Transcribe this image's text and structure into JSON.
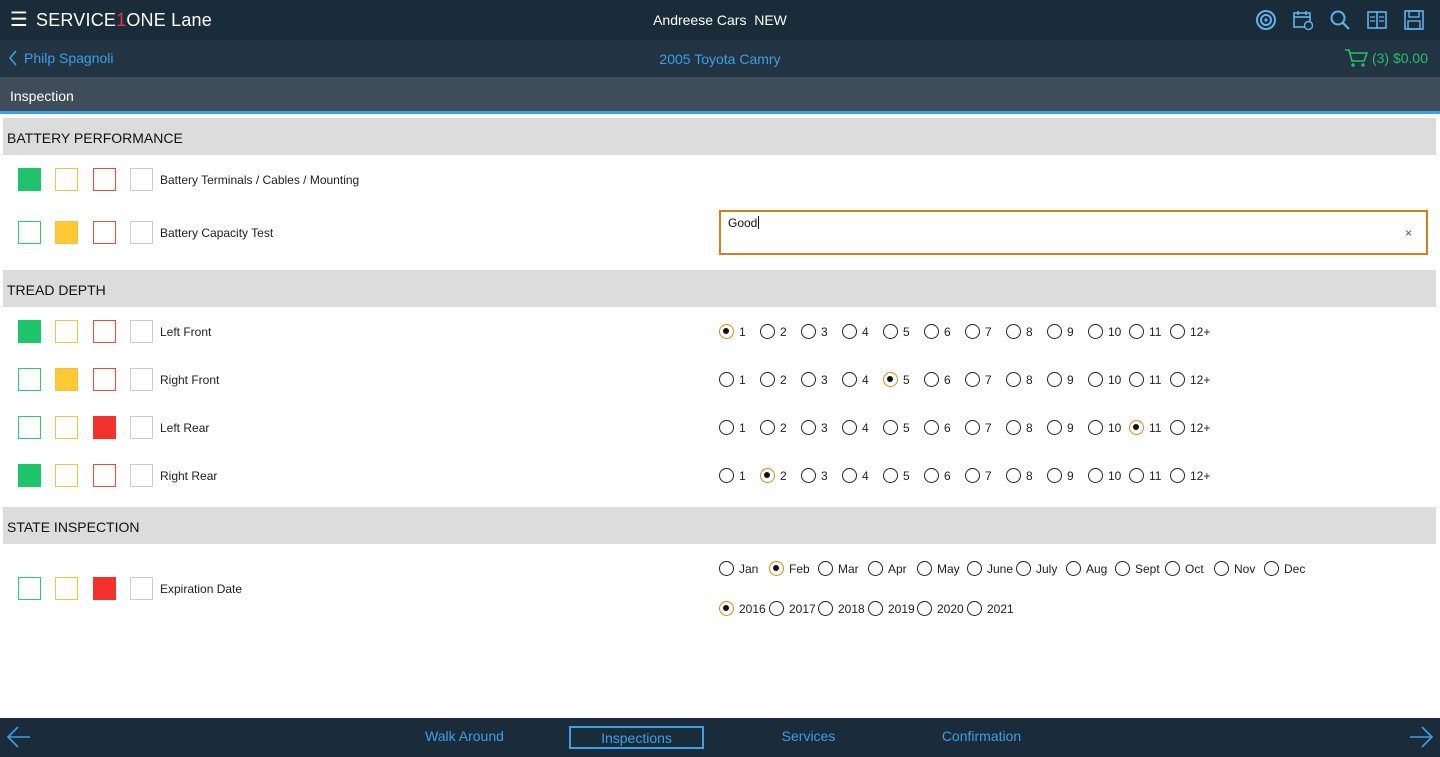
{
  "app": {
    "menu_icon": "hamburger-icon",
    "brand_prefix": "SERVICE",
    "brand_one": "1",
    "brand_suffix": "ONE Lane",
    "dealer": "Andreese Cars  NEW",
    "toolbar_icons": [
      "dashboard-icon",
      "calendar-icon",
      "search-icon",
      "book-icon",
      "save-icon"
    ]
  },
  "subheader": {
    "customer": "Philp Spagnoli",
    "vehicle": "2005 Toyota Camry",
    "cart_label": "(3) $0.00"
  },
  "page": {
    "title": "Inspection"
  },
  "colors": {
    "green": "#1ec46a",
    "yellow": "#fdc934",
    "red": "#f2322c",
    "accent": "#3aa0e8",
    "focus": "#d07f1a"
  },
  "sections": {
    "battery": {
      "title": "BATTERY PERFORMANCE",
      "rows": [
        {
          "label": "Battery Terminals / Cables / Mounting",
          "status": "green"
        },
        {
          "label": "Battery Capacity Test",
          "status": "yellow",
          "note_value": "Good",
          "clear_symbol": "×"
        }
      ]
    },
    "tread": {
      "title": "TREAD DEPTH",
      "options": [
        "1",
        "2",
        "3",
        "4",
        "5",
        "6",
        "7",
        "8",
        "9",
        "10",
        "11",
        "12+"
      ],
      "rows": [
        {
          "label": "Left Front",
          "status": "green",
          "selected": "1"
        },
        {
          "label": "Right Front",
          "status": "yellow",
          "selected": "5"
        },
        {
          "label": "Left Rear",
          "status": "red",
          "selected": "11"
        },
        {
          "label": "Right Rear",
          "status": "green",
          "selected": "2"
        }
      ]
    },
    "state": {
      "title": "STATE INSPECTION",
      "rows": [
        {
          "label": "Expiration Date",
          "status": "red",
          "months": [
            "Jan",
            "Feb",
            "Mar",
            "Apr",
            "May",
            "June",
            "July",
            "Aug",
            "Sept",
            "Oct",
            "Nov",
            "Dec"
          ],
          "selected_month": "Feb",
          "years": [
            "2016",
            "2017",
            "2018",
            "2019",
            "2020",
            "2021"
          ],
          "selected_year": "2016"
        }
      ]
    }
  },
  "footer": {
    "tabs": [
      {
        "label": "Walk Around",
        "active": false
      },
      {
        "label": "Inspections",
        "active": true
      },
      {
        "label": "Services",
        "active": false
      },
      {
        "label": "Confirmation",
        "active": false
      }
    ],
    "prev_icon": "arrow-left-icon",
    "next_icon": "arrow-right-icon"
  }
}
